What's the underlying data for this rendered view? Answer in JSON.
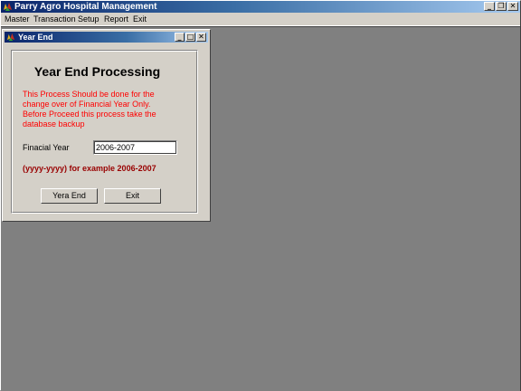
{
  "app": {
    "title": "Parry Agro Hospital Management",
    "window_buttons": {
      "minimize": "_",
      "restore": "❐",
      "close": "✕"
    }
  },
  "menu": {
    "items": [
      "Master",
      "Transaction",
      "Setup",
      "Report",
      "Exit"
    ]
  },
  "child_window": {
    "title": "Year End",
    "window_buttons": {
      "minimize": "_",
      "maximize": "□",
      "close": "✕"
    }
  },
  "form": {
    "heading": "Year End Processing",
    "warning_lines": [
      "This Process Should be done for the",
      "change over of  Financial Year Only.",
      "Before Proceed this process take the",
      "database backup"
    ],
    "financial_year_label": "Finacial Year",
    "financial_year_value": "2006-2007",
    "example_text": "(yyyy-yyyy) for example  2006-2007",
    "year_end_button": "Yera End",
    "exit_button": "Exit"
  },
  "colors": {
    "warning_text": "#ff0000",
    "example_text": "#990000",
    "mdi_background": "#808080",
    "window_face": "#d4d0c8"
  }
}
